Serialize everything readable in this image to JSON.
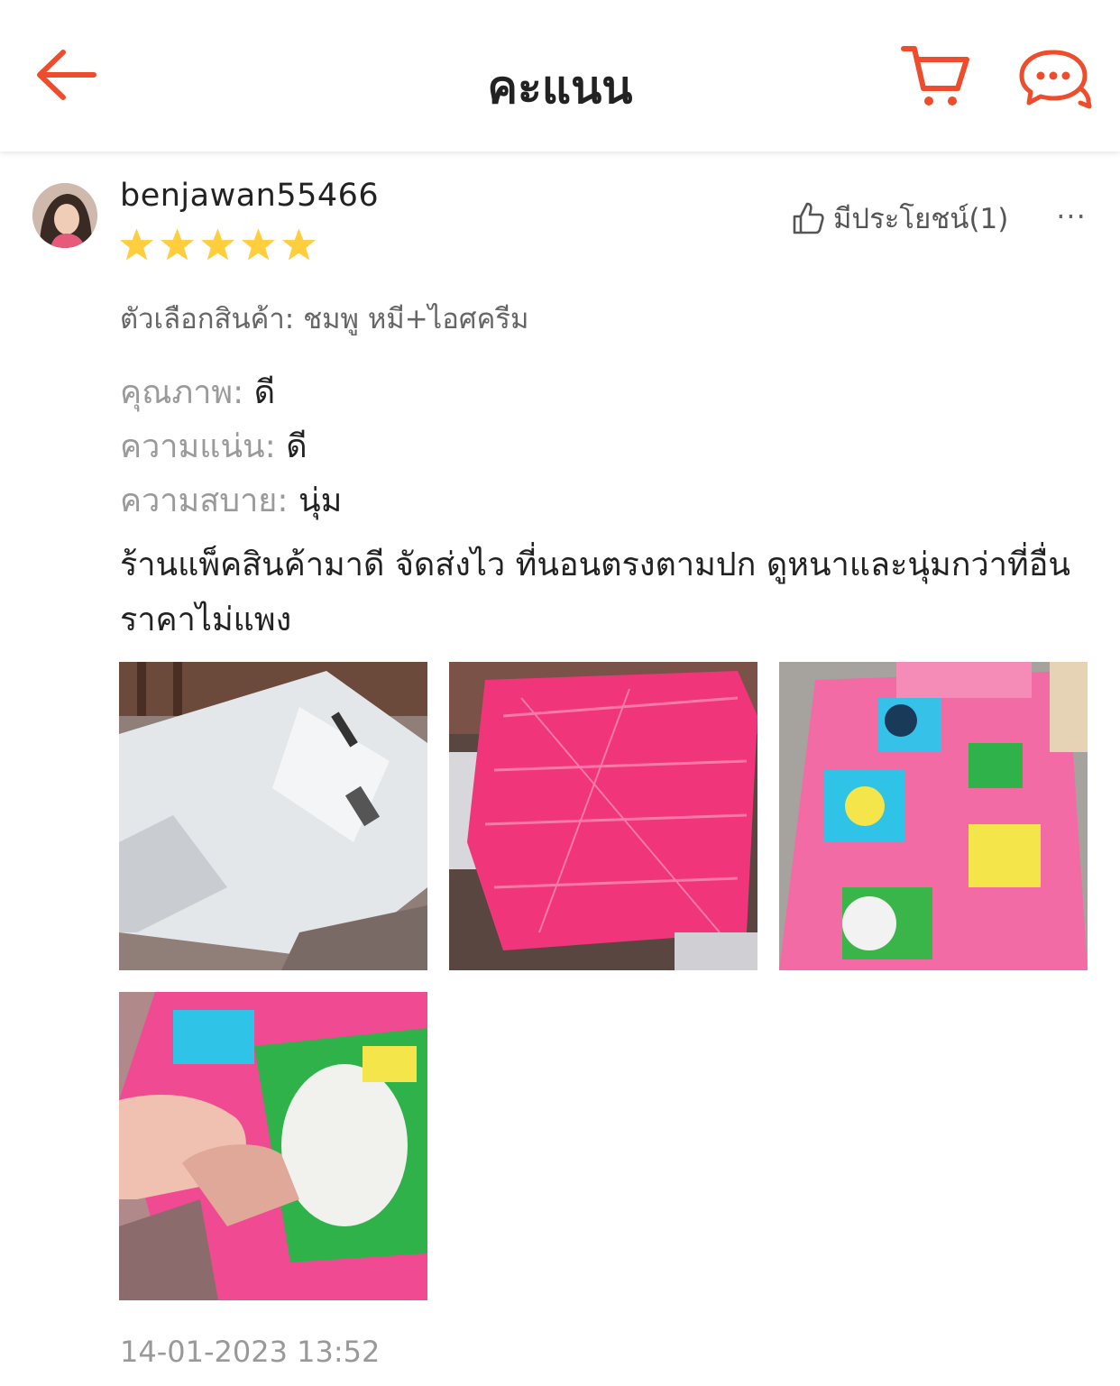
{
  "header": {
    "title": "คะแนน",
    "accent_color": "#EE4D2D",
    "icons": [
      "back-arrow-icon",
      "cart-icon",
      "chat-icon"
    ]
  },
  "review": {
    "username": "benjawan55466",
    "rating": 5,
    "max_rating": 5,
    "star_color": "#FFCE3D",
    "helpful_label": "มีประโยชน์(1)",
    "more_label": "···",
    "variation": "ตัวเลือกสินค้า: ชมพู หมี+ไอศครีม",
    "attributes": [
      {
        "label": "คุณภาพ:",
        "value": "ดี"
      },
      {
        "label": "ความแน่น:",
        "value": "ดี"
      },
      {
        "label": "ความสบาย:",
        "value": "นุ่ม"
      }
    ],
    "comment": "ร้านแพ็คสินค้ามาดี จัดส่งไว ที่นอนตรงตามปก ดูหนาและนุ่มกว่าที่อื่น ราคาไม่แพง",
    "photos": [
      {
        "name": "white package bag"
      },
      {
        "name": "pink mattress in plastic"
      },
      {
        "name": "pink cartoon mattress laid out"
      },
      {
        "name": "hand pressing pink mattress"
      }
    ],
    "timestamp": "14-01-2023 13:52"
  }
}
